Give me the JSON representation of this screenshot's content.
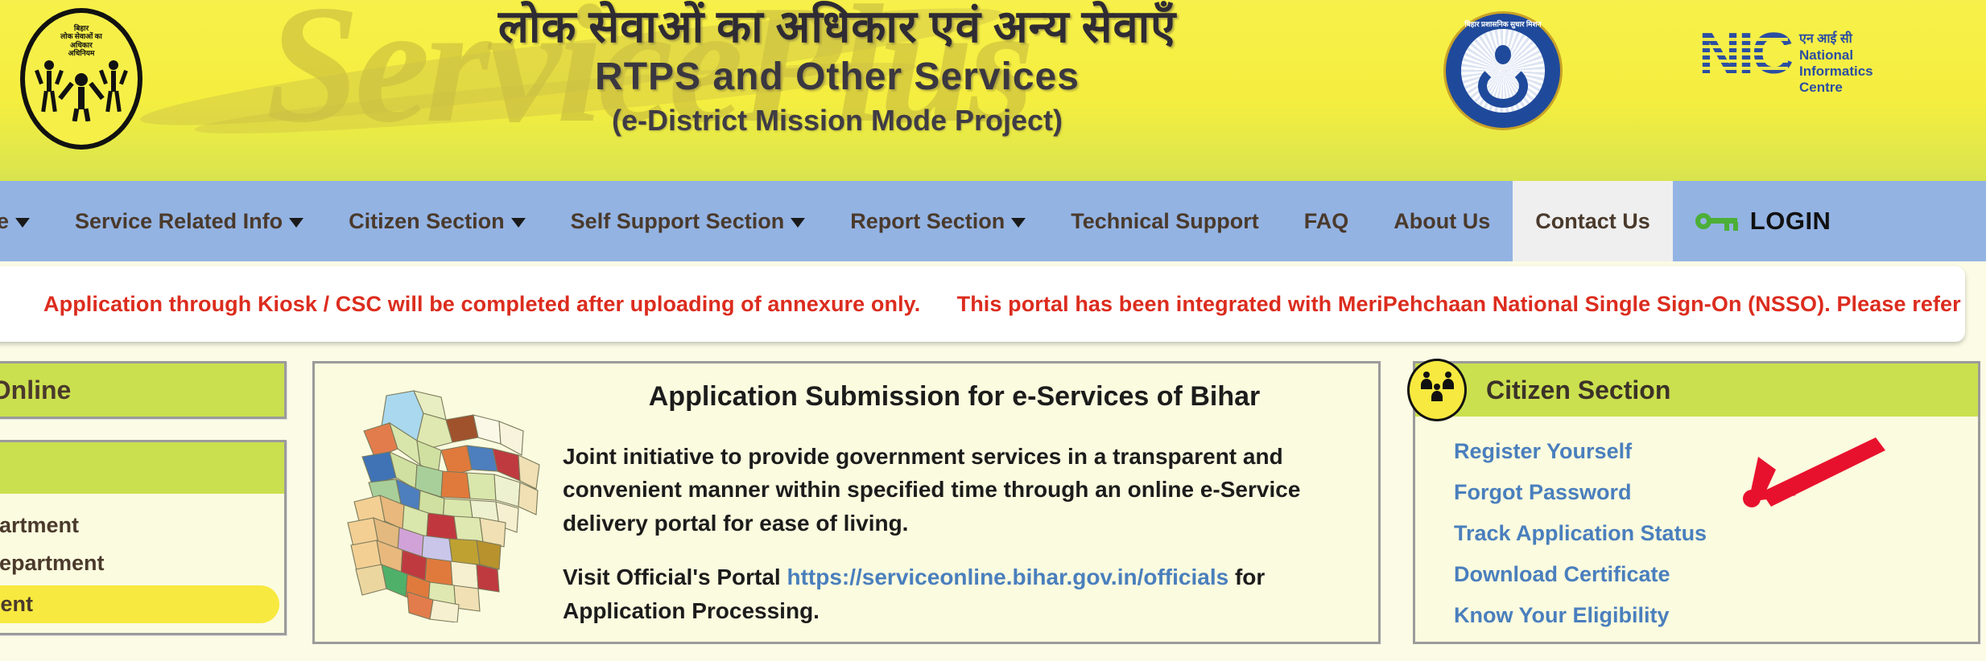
{
  "header": {
    "emblem_left": {
      "name": "bihar-rtps-emblem",
      "line1": "बिहार",
      "line2": "लोक सेवाओं का",
      "line3": "अधिकार",
      "line4": "अधिनियम"
    },
    "watermark": "ServicePlus",
    "title_hindi": "लोक सेवाओं का अधिकार एवं अन्य सेवाएँ",
    "title_english": "RTPS and Other Services",
    "subtitle": "(e-District Mission Mode Project)",
    "seal_mid_label": "बिहार प्रशासनिक सुधार मिशन",
    "nic": {
      "mark": "NIC",
      "hindi": "एन आई सी",
      "line1": "National",
      "line2": "Informatics",
      "line3": "Centre"
    }
  },
  "nav": {
    "items": [
      {
        "label": "e",
        "caret": true,
        "active": false,
        "truncated": true
      },
      {
        "label": "Service Related Info",
        "caret": true,
        "active": false
      },
      {
        "label": "Citizen Section",
        "caret": true,
        "active": false
      },
      {
        "label": "Self Support Section",
        "caret": true,
        "active": false
      },
      {
        "label": "Report Section",
        "caret": true,
        "active": false
      },
      {
        "label": "Technical Support",
        "caret": false,
        "active": false
      },
      {
        "label": "FAQ",
        "caret": false,
        "active": false
      },
      {
        "label": "About Us",
        "caret": false,
        "active": false
      },
      {
        "label": "Contact Us",
        "caret": false,
        "active": true
      }
    ],
    "login_label": "LOGIN",
    "login_icon": "key-icon"
  },
  "marquee": {
    "text_part1": "Application through Kiosk / CSC will be completed after uploading of annexure only.",
    "text_part2": "This portal has been integrated with MeriPehchaan National Single Sign-On (NSSO). Please refer “Usage Ins",
    "color": "#dc2c1e"
  },
  "sidebar": {
    "apply_online_label": "Apply Online",
    "departments_header": "",
    "departments": [
      {
        "label": "tion Department",
        "highlight": false
      },
      {
        "label": "oment Department",
        "highlight": false
      },
      {
        "label": "Department",
        "highlight": true
      }
    ]
  },
  "center": {
    "map_alt": "bihar-district-map",
    "title": "Application Submission for e-Services of Bihar",
    "para1": "Joint initiative to provide government services in a transparent and convenient manner within specified time through an online e-Service delivery portal for ease of living.",
    "visit_prefix": "Visit Official's Portal ",
    "portal_url": "https://serviceonline.bihar.gov.in/officials",
    "visit_suffix": " for Application Processing."
  },
  "citizen_section": {
    "title": "Citizen Section",
    "icon": "people-group-icon",
    "links": [
      "Register Yourself",
      "Forgot Password",
      "Track Application Status",
      "Download Certificate",
      "Know Your Eligibility"
    ],
    "annotation_arrow": {
      "name": "red-arrow-annotation",
      "color": "#e8112d",
      "points_to": "Forgot Password"
    }
  },
  "colors": {
    "banner_yellow": "#f6ef48",
    "nav_blue": "#93b3e3",
    "panel_green": "#cbe04f",
    "panel_cream": "#fbfbdf",
    "link_blue": "#4a7fbd",
    "marquee_red": "#dc2c1e",
    "highlight_yellow": "#f7e93f"
  }
}
